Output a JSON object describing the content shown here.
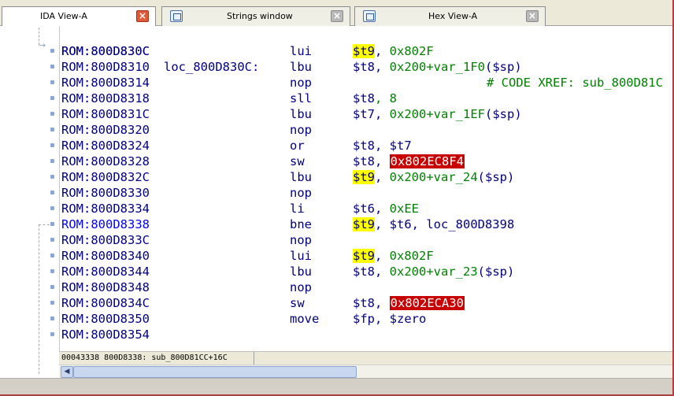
{
  "tabs": [
    {
      "label": "IDA View-A",
      "icon": "none",
      "active": true,
      "close": "red"
    },
    {
      "label": "Strings window",
      "icon": "strings-icon",
      "active": false,
      "close": "grey"
    },
    {
      "label": "Hex View-A",
      "icon": "hex-icon",
      "active": false,
      "close": "grey"
    }
  ],
  "disasm": {
    "header": {
      "address": "ROM:800D830C",
      "label": "loc_800D830C:",
      "comment": "# CODE XREF: sub_800D81C"
    },
    "rows": [
      {
        "address": "ROM:800D830C",
        "mnemonic": "lui",
        "op1": "$t9",
        "rest": ", 0x802F"
      },
      {
        "address": "ROM:800D8310",
        "mnemonic": "lbu",
        "op1": "$t8",
        "rest": ", 0x200+var_1F0($sp)"
      },
      {
        "address": "ROM:800D8314",
        "mnemonic": "nop",
        "op1": "",
        "rest": ""
      },
      {
        "address": "ROM:800D8318",
        "mnemonic": "sll",
        "op1": "$t8",
        "rest": ", 8"
      },
      {
        "address": "ROM:800D831C",
        "mnemonic": "lbu",
        "op1": "$t7",
        "rest": ", 0x200+var_1EF($sp)"
      },
      {
        "address": "ROM:800D8320",
        "mnemonic": "nop",
        "op1": "",
        "rest": ""
      },
      {
        "address": "ROM:800D8324",
        "mnemonic": "or",
        "op1": "$t8",
        "rest": ", $t7"
      },
      {
        "address": "ROM:800D8328",
        "mnemonic": "sw",
        "op1": "$t8",
        "rest": ", ",
        "boxed": "0x802EC8F4"
      },
      {
        "address": "ROM:800D832C",
        "mnemonic": "lbu",
        "op1": "$t9",
        "rest": ", 0x200+var_24($sp)"
      },
      {
        "address": "ROM:800D8330",
        "mnemonic": "nop",
        "op1": "",
        "rest": ""
      },
      {
        "address": "ROM:800D8334",
        "mnemonic": "li",
        "op1": "$t6",
        "rest": ", 0xEE"
      },
      {
        "address": "ROM:800D8338",
        "mnemonic": "bne",
        "op1": "$t9",
        "rest": ", $t6, loc_800D8398"
      },
      {
        "address": "ROM:800D833C",
        "mnemonic": "nop",
        "op1": "",
        "rest": ""
      },
      {
        "address": "ROM:800D8340",
        "mnemonic": "lui",
        "op1": "$t9",
        "rest": ", 0x802F"
      },
      {
        "address": "ROM:800D8344",
        "mnemonic": "lbu",
        "op1": "$t8",
        "rest": ", 0x200+var_23($sp)"
      },
      {
        "address": "ROM:800D8348",
        "mnemonic": "nop",
        "op1": "",
        "rest": ""
      },
      {
        "address": "ROM:800D834C",
        "mnemonic": "sw",
        "op1": "$t8",
        "rest": ", ",
        "boxed": "0x802ECA30"
      },
      {
        "address": "ROM:800D8350",
        "mnemonic": "move",
        "op1": "$fp",
        "rest": ", $zero"
      },
      {
        "address": "ROM:800D8354",
        "mnemonic": "",
        "op1": "",
        "rest": ""
      }
    ]
  },
  "status": {
    "text": "00043338 800D8338: sub_800D81CC+16C"
  },
  "colors": {
    "highlight_register": "#ffff00",
    "boxed_value": "#c80000",
    "current_address": "#0000ff",
    "code_text": "#000080",
    "comment": "#008000"
  }
}
